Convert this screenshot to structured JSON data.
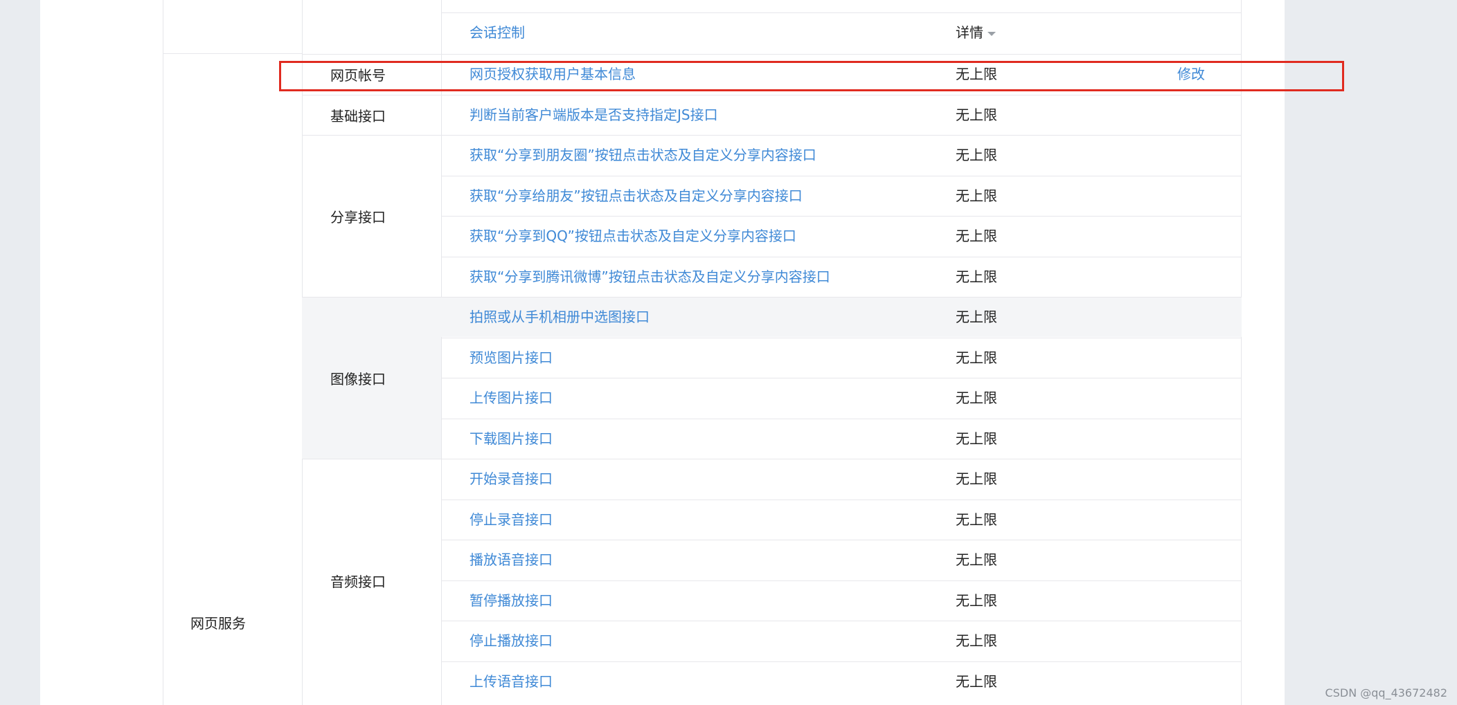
{
  "service_name": "网页服务",
  "prev_row": {
    "api": "会话控制",
    "quota_label": "详情"
  },
  "categories": [
    {
      "name": "网页帐号",
      "rows": [
        {
          "api": "网页授权获取用户基本信息",
          "quota": "无上限",
          "action": "修改"
        }
      ]
    },
    {
      "name": "基础接口",
      "rows": [
        {
          "api": "判断当前客户端版本是否支持指定JS接口",
          "quota": "无上限"
        }
      ]
    },
    {
      "name": "分享接口",
      "rows": [
        {
          "api": "获取“分享到朋友圈”按钮点击状态及自定义分享内容接口",
          "quota": "无上限"
        },
        {
          "api": "获取“分享给朋友”按钮点击状态及自定义分享内容接口",
          "quota": "无上限"
        },
        {
          "api": "获取“分享到QQ”按钮点击状态及自定义分享内容接口",
          "quota": "无上限"
        },
        {
          "api": "获取“分享到腾讯微博”按钮点击状态及自定义分享内容接口",
          "quota": "无上限"
        }
      ]
    },
    {
      "name": "图像接口",
      "rows": [
        {
          "api": "拍照或从手机相册中选图接口",
          "quota": "无上限"
        },
        {
          "api": "预览图片接口",
          "quota": "无上限"
        },
        {
          "api": "上传图片接口",
          "quota": "无上限"
        },
        {
          "api": "下载图片接口",
          "quota": "无上限"
        }
      ]
    },
    {
      "name": "音频接口",
      "rows": [
        {
          "api": "开始录音接口",
          "quota": "无上限"
        },
        {
          "api": "停止录音接口",
          "quota": "无上限"
        },
        {
          "api": "播放语音接口",
          "quota": "无上限"
        },
        {
          "api": "暂停播放接口",
          "quota": "无上限"
        },
        {
          "api": "停止播放接口",
          "quota": "无上限"
        },
        {
          "api": "上传语音接口",
          "quota": "无上限"
        }
      ]
    }
  ],
  "watermark": "CSDN @qq_43672482",
  "colors": {
    "link": "#3f89d6",
    "highlight_border": "#e02b20",
    "grey_row": "#f4f5f7",
    "page_bg": "#e9ecf0"
  }
}
